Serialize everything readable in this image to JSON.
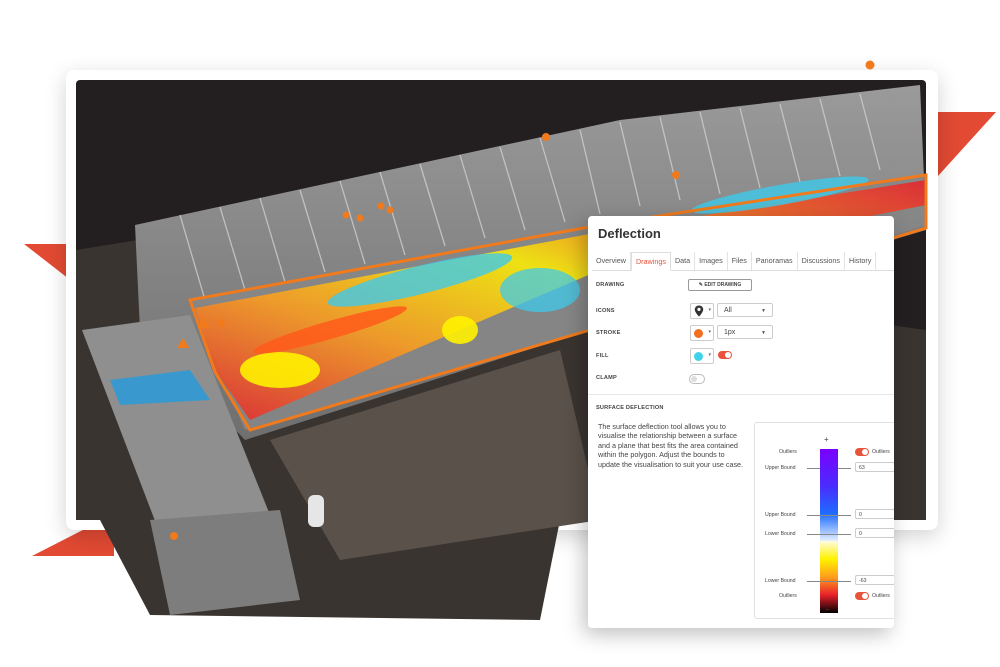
{
  "panel": {
    "title": "Deflection",
    "tabs": [
      "Overview",
      "Drawings",
      "Data",
      "Images",
      "Files",
      "Panoramas",
      "Discussions",
      "History"
    ],
    "active_tab": "Drawings",
    "drawing_label": "DRAWING",
    "edit_drawing_label": "EDIT DRAWING",
    "icons_label": "ICONS",
    "icons_value": "All",
    "stroke_label": "STROKE",
    "stroke_value": "1px",
    "stroke_color": "#f07020",
    "fill_label": "FILL",
    "fill_color": "#3fd3ea",
    "fill_enabled": true,
    "clamp_label": "CLAMP",
    "clamp_enabled": false,
    "surface_deflection_label": "SURFACE DEFLECTION",
    "description": "The surface deflection tool allows you to visualise the relationship between a surface and a plane that best fits the area contained within the polygon. Adjust the bounds to update the visualisation to suit your use case.",
    "legend": {
      "plus": "+",
      "minus": "−",
      "outliers_top": "Outliers",
      "outliers_top_toggle": "Outliers",
      "upper_bound_1": "Upper Bound",
      "upper_bound_1_value": "63",
      "upper_bound_2": "Upper Bound",
      "upper_bound_2_value": "0",
      "lower_bound_1": "Lower Bound",
      "lower_bound_1_value": "0",
      "lower_bound_2": "Lower Bound",
      "lower_bound_2_value": "-63",
      "outliers_bottom": "Outliers",
      "outliers_bottom_toggle": "Outliers"
    }
  },
  "colors": {
    "accent": "#e8533b",
    "marker": "#f07a1c",
    "viewport_bg": "#231f20"
  }
}
